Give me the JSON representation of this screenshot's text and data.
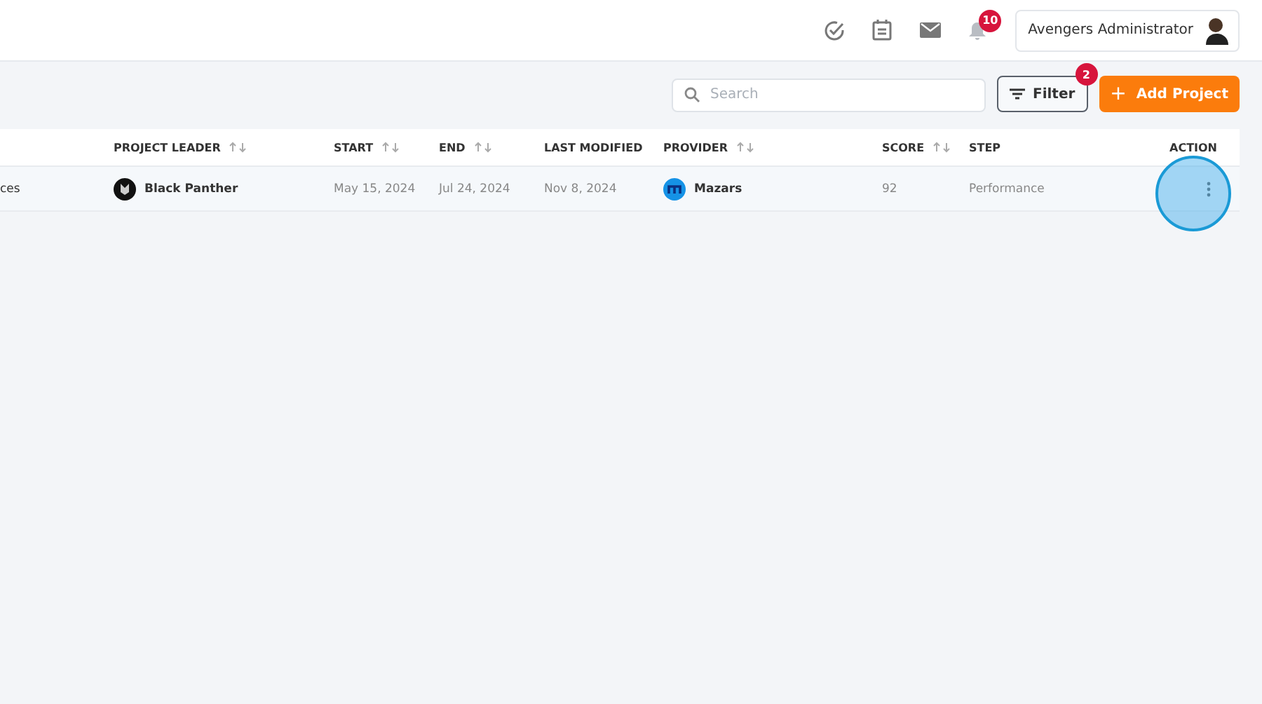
{
  "header": {
    "notifications_count": "10",
    "user_name": "Avengers Administrator"
  },
  "toolbar": {
    "search": {
      "placeholder": "Search"
    },
    "filter": {
      "label": "Filter",
      "count": "2"
    },
    "add_button": {
      "icon": "+",
      "label": "Add Project"
    }
  },
  "table": {
    "columns": [
      {
        "label": "PROJECT LEADER",
        "sortable": true
      },
      {
        "label": "START",
        "sortable": true
      },
      {
        "label": "END",
        "sortable": true
      },
      {
        "label": "LAST MODIFIED",
        "sortable": false
      },
      {
        "label": "PROVIDER",
        "sortable": true
      },
      {
        "label": "SCORE",
        "sortable": true
      },
      {
        "label": "STEP",
        "sortable": false
      },
      {
        "label": "ACTION",
        "sortable": false
      }
    ],
    "rows": [
      {
        "column_1": "ces",
        "project_leader": "Black Panther",
        "start": "May 15, 2024",
        "end": "Jul 24, 2024",
        "last_modified": "Nov 8, 2024",
        "provider": "Mazars",
        "score": "92",
        "step": "Performance"
      }
    ]
  }
}
